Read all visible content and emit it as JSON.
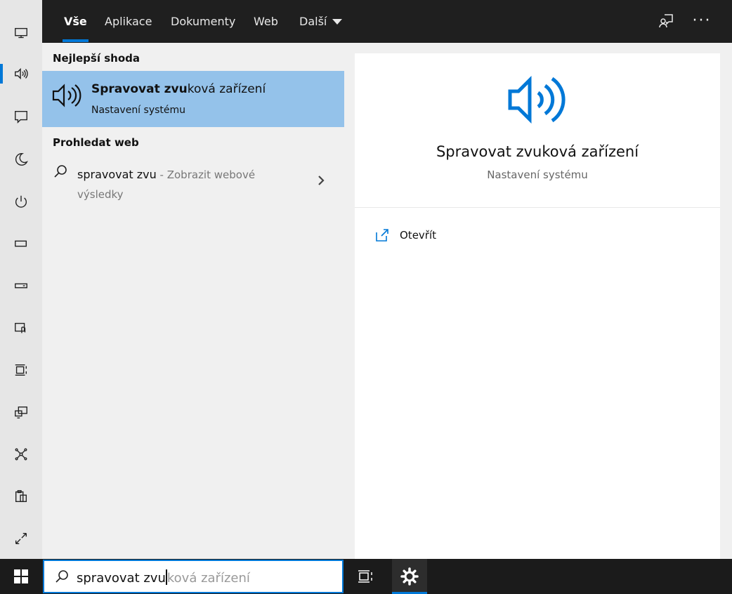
{
  "colors": {
    "accent": "#0078d7",
    "selection": "#94c2ea",
    "taskbar": "#1b1b1b",
    "tabbar": "#1f1f1f"
  },
  "rail": {
    "items": [
      {
        "icon": "display-icon"
      },
      {
        "icon": "sound-icon",
        "active": true
      },
      {
        "icon": "notifications-icon"
      },
      {
        "icon": "focus-assist-moon-icon"
      },
      {
        "icon": "power-icon"
      },
      {
        "icon": "battery-icon"
      },
      {
        "icon": "storage-icon"
      },
      {
        "icon": "tablet-mode-icon"
      },
      {
        "icon": "multitasking-icon"
      },
      {
        "icon": "projecting-icon"
      },
      {
        "icon": "shared-experiences-icon"
      },
      {
        "icon": "clipboard-icon"
      },
      {
        "icon": "remote-desktop-icon"
      }
    ]
  },
  "tabs": [
    {
      "label": "Vše",
      "active": true
    },
    {
      "label": "Aplikace"
    },
    {
      "label": "Dokumenty"
    },
    {
      "label": "Web"
    },
    {
      "label": "Další",
      "dropdown": true
    }
  ],
  "topbar": {
    "feedback_icon": "feedback-icon",
    "more_label": "···"
  },
  "results": {
    "best_match_title": "Nejlepší shoda",
    "best_match": {
      "title_bold": "Spravovat zvu",
      "title_rest": "ková zařízení",
      "subtitle": "Nastavení systému"
    },
    "web_title": "Prohledat web",
    "web_item": {
      "query": "spravovat zvu",
      "suffix": " - Zobrazit webové výsledky"
    }
  },
  "preview": {
    "title": "Spravovat zvuková zařízení",
    "subtitle": "Nastavení systému",
    "open_label": "Otevřít"
  },
  "taskbar": {
    "search_typed": "spravovat zvu",
    "search_suggest": "ková zařízení"
  }
}
